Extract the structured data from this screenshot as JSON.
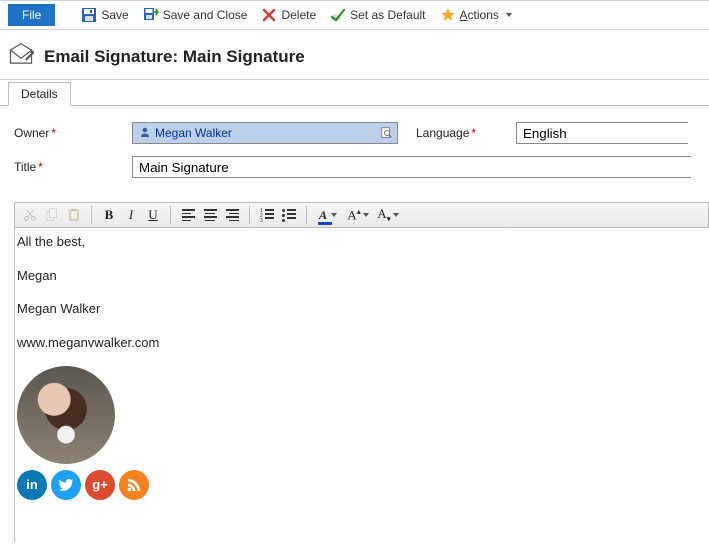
{
  "ribbon": {
    "file": "File",
    "save": "Save",
    "save_and_close": "Save and Close",
    "delete": "Delete",
    "set_as_default": "Set as Default",
    "actions_prefix": "A",
    "actions_rest": "ctions"
  },
  "header": {
    "title": "Email Signature: Main Signature"
  },
  "tabs": {
    "details": "Details"
  },
  "form": {
    "owner_label": "Owner",
    "owner_value": "Megan Walker",
    "language_label": "Language",
    "language_value": "English",
    "title_label": "Title",
    "title_value": "Main Signature"
  },
  "signature": {
    "line1": "All the best,",
    "line2": "Megan",
    "line3": "Megan Walker",
    "line4": "www.meganvwalker.com",
    "social": {
      "linkedin": "in",
      "twitter": "",
      "googleplus": "g+",
      "rss": ""
    }
  }
}
